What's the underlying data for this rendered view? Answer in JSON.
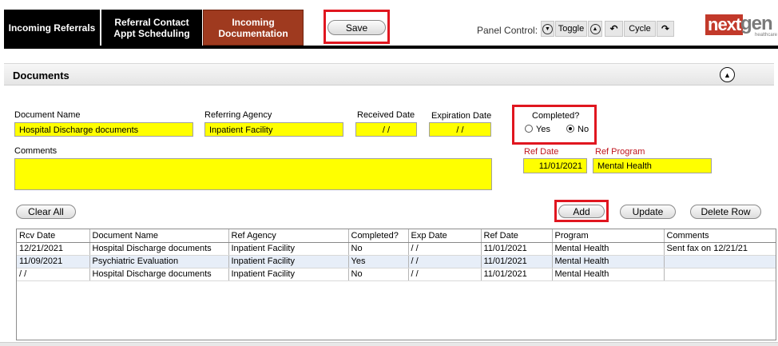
{
  "tabs": [
    {
      "label": "Incoming Referrals"
    },
    {
      "label": "Referral Contact\nAppt Scheduling"
    },
    {
      "label": "Incoming\nDocumentation"
    }
  ],
  "toolbar": {
    "save_label": "Save"
  },
  "panel_control": {
    "label": "Panel Control:",
    "toggle_label": "Toggle",
    "cycle_label": "Cycle"
  },
  "logo": {
    "text_a": "next",
    "text_b": "gen",
    "sub": "healthcare"
  },
  "section": {
    "title": "Documents"
  },
  "form": {
    "document_name": {
      "label": "Document Name",
      "value": "Hospital Discharge documents"
    },
    "referring_agency": {
      "label": "Referring Agency",
      "value": "Inpatient Facility"
    },
    "received_date": {
      "label": "Received Date",
      "value": "/ /"
    },
    "expiration_date": {
      "label": "Expiration Date",
      "value": "/ /"
    },
    "completed": {
      "label": "Completed?",
      "yes_label": "Yes",
      "no_label": "No",
      "selected": "No"
    },
    "comments": {
      "label": "Comments",
      "value": ""
    },
    "ref_date": {
      "label": "Ref Date",
      "value": "11/01/2021"
    },
    "ref_program": {
      "label": "Ref Program",
      "value": "Mental Health"
    }
  },
  "buttons": {
    "clear_all": "Clear All",
    "add": "Add",
    "update": "Update",
    "delete_row": "Delete Row"
  },
  "grid": {
    "columns": [
      "Rcv Date",
      "Document Name",
      "Ref Agency",
      "Completed?",
      "Exp Date",
      "Ref Date",
      "Program",
      "Comments"
    ],
    "rows": [
      [
        "12/21/2021",
        "Hospital Discharge documents",
        "Inpatient Facility",
        "No",
        " / /",
        "11/01/2021",
        "Mental Health",
        "Sent fax on 12/21/21"
      ],
      [
        "11/09/2021",
        "Psychiatric Evaluation",
        "Inpatient Facility",
        "Yes",
        " / /",
        "11/01/2021",
        "Mental Health",
        ""
      ],
      [
        " / /",
        "Hospital Discharge documents",
        "Inpatient Facility",
        "No",
        " / /",
        "11/01/2021",
        "Mental Health",
        ""
      ]
    ]
  },
  "colors": {
    "active_tab": "#9f3a1f",
    "highlight": "#e0161f",
    "field_bg": "#ffff00",
    "red_label": "#c0161f"
  }
}
